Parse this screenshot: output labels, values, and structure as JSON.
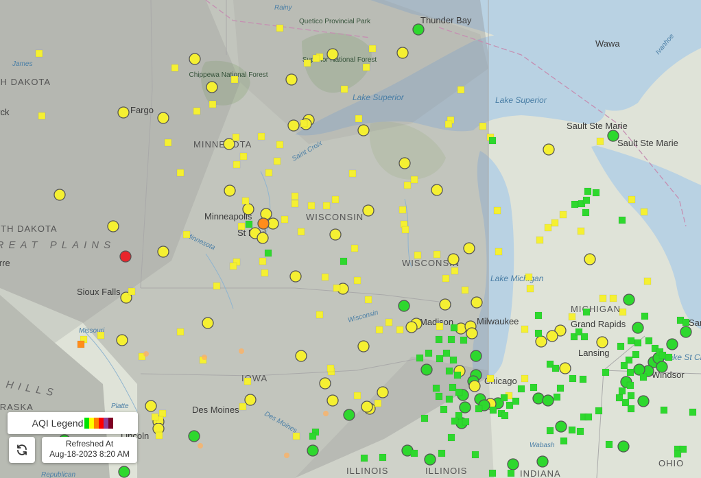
{
  "map": {
    "place_labels": [
      {
        "text": "Thunder Bay"
      },
      {
        "text": "Wawa"
      },
      {
        "text": "Fargo"
      },
      {
        "text": "Sault Ste Marie"
      },
      {
        "text": "Sault Ste Marie"
      },
      {
        "text": "MINNESOTA"
      },
      {
        "text": "Minneapolis"
      },
      {
        "text": "St Paul"
      },
      {
        "text": "WISCONSIN"
      },
      {
        "text": "WISCONSIN"
      },
      {
        "text": "Madison"
      },
      {
        "text": "Milwaukee"
      },
      {
        "text": "Chicago"
      },
      {
        "text": "Grand Rapids"
      },
      {
        "text": "Lansing"
      },
      {
        "text": "MICHIGAN"
      },
      {
        "text": "Windsor"
      },
      {
        "text": "Sioux Falls"
      },
      {
        "text": "Des Moines"
      },
      {
        "text": "IOWA"
      },
      {
        "text": "ILLINOIS"
      },
      {
        "text": "ILLINOIS"
      },
      {
        "text": "INDIANA"
      },
      {
        "text": "OHIO"
      },
      {
        "text": "NORTH DAKOTA"
      },
      {
        "text": "SOUTH DAKOTA"
      },
      {
        "text": "GREAT PLAINS"
      },
      {
        "text": "Bismarck"
      },
      {
        "text": "Pierre"
      },
      {
        "text": "HILLS"
      },
      {
        "text": "NEBRASKA"
      },
      {
        "text": "Lincoln"
      },
      {
        "text": "Sarnia"
      }
    ],
    "water_labels": [
      "Lake Superior",
      "Lake Superior",
      "Lake Michigan",
      "Lake St Clair",
      "Rainy",
      "James",
      "Missouri",
      "Platte",
      "Republican",
      "Wabash",
      "Des Moines",
      "Wisconsin",
      "Minnesota",
      "Saint Croix",
      "Ivanhoe"
    ],
    "park_labels": [
      "Quetico Provincial Park",
      "Superior National Forest",
      "Chippewa National Forest"
    ]
  },
  "legend": {
    "title": "AQI Legend",
    "colors": [
      "#00e400",
      "#ffff00",
      "#ff7e00",
      "#ff0000",
      "#8f3f97",
      "#7e0023"
    ]
  },
  "refresh": {
    "icon": "refresh-icon",
    "label": "Refreshed At",
    "timestamp": "Aug-18-2023 8:20 AM"
  },
  "aqi_colors": {
    "good": "#2ed82e",
    "moderate": "#f5f032",
    "usg": "#ff8c1a",
    "unhealthy": "#e8252b"
  }
}
